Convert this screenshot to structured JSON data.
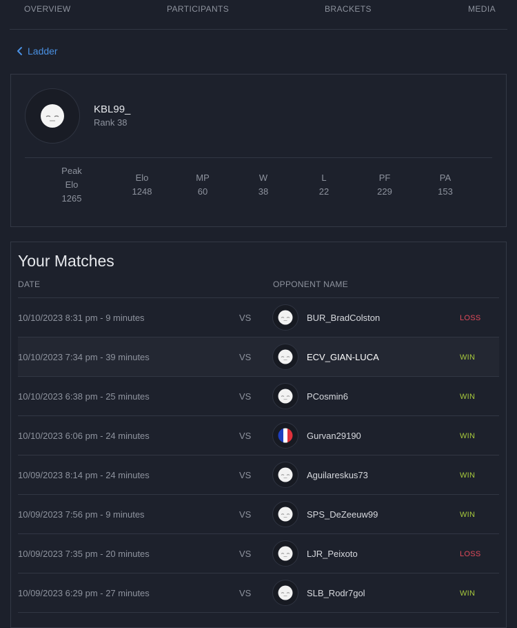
{
  "nav": {
    "tabs": [
      "OVERVIEW",
      "PARTICIPANTS",
      "BRACKETS",
      "MEDIA"
    ]
  },
  "back_link": {
    "label": "Ladder",
    "icon": "chevron-left-icon"
  },
  "profile": {
    "name": "KBL99_",
    "rank": "Rank 38",
    "stats": [
      {
        "label_line1": "Peak",
        "label_line2": "Elo",
        "value": "1265"
      },
      {
        "label": "Elo",
        "value": "1248"
      },
      {
        "label": "MP",
        "value": "60"
      },
      {
        "label": "W",
        "value": "38"
      },
      {
        "label": "L",
        "value": "22"
      },
      {
        "label": "PF",
        "value": "229"
      },
      {
        "label": "PA",
        "value": "153"
      }
    ]
  },
  "matches": {
    "title": "Your Matches",
    "columns": {
      "date": "DATE",
      "opponent": "OPPONENT NAME"
    },
    "vs_label": "VS",
    "rows": [
      {
        "date": "10/10/2023 8:31 pm - 9 minutes",
        "opponent": "BUR_BradColston",
        "result": "LOSS",
        "avatar": "face-avatar"
      },
      {
        "date": "10/10/2023 7:34 pm - 39 minutes",
        "opponent": "ECV_GIAN-LUCA",
        "result": "WIN",
        "avatar": "face-avatar"
      },
      {
        "date": "10/10/2023 6:38 pm - 25 minutes",
        "opponent": "PCosmin6",
        "result": "WIN",
        "avatar": "face-avatar"
      },
      {
        "date": "10/10/2023 6:06 pm - 24 minutes",
        "opponent": "Gurvan29190",
        "result": "WIN",
        "avatar": "french-flag-avatar"
      },
      {
        "date": "10/09/2023 8:14 pm - 24 minutes",
        "opponent": "Aguilareskus73",
        "result": "WIN",
        "avatar": "face-avatar"
      },
      {
        "date": "10/09/2023 7:56 pm - 9 minutes",
        "opponent": "SPS_DeZeeuw99",
        "result": "WIN",
        "avatar": "face-avatar"
      },
      {
        "date": "10/09/2023 7:35 pm - 20 minutes",
        "opponent": "LJR_Peixoto",
        "result": "LOSS",
        "avatar": "face-avatar"
      },
      {
        "date": "10/09/2023 6:29 pm - 27 minutes",
        "opponent": "SLB_Rodr7gol",
        "result": "WIN",
        "avatar": "face-avatar"
      }
    ]
  },
  "colors": {
    "background": "#1c202b",
    "accent_link": "#4a90e2",
    "win": "#a7c93c",
    "loss": "#e04a5a"
  }
}
